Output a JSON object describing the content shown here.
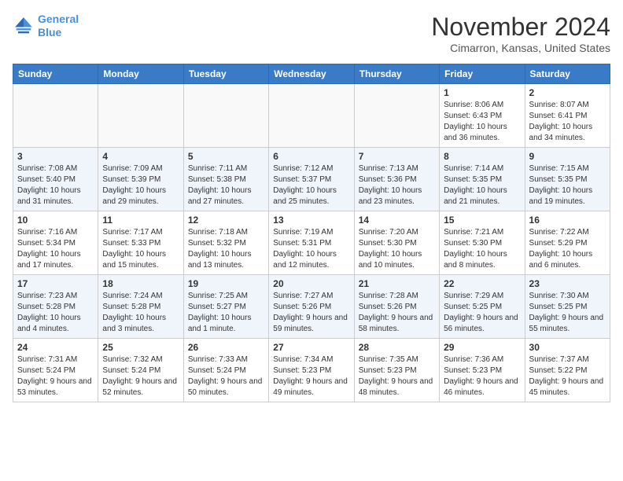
{
  "header": {
    "logo_line1": "General",
    "logo_line2": "Blue",
    "month": "November 2024",
    "location": "Cimarron, Kansas, United States"
  },
  "days_of_week": [
    "Sunday",
    "Monday",
    "Tuesday",
    "Wednesday",
    "Thursday",
    "Friday",
    "Saturday"
  ],
  "weeks": [
    [
      {
        "day": "",
        "info": ""
      },
      {
        "day": "",
        "info": ""
      },
      {
        "day": "",
        "info": ""
      },
      {
        "day": "",
        "info": ""
      },
      {
        "day": "",
        "info": ""
      },
      {
        "day": "1",
        "info": "Sunrise: 8:06 AM\nSunset: 6:43 PM\nDaylight: 10 hours and 36 minutes."
      },
      {
        "day": "2",
        "info": "Sunrise: 8:07 AM\nSunset: 6:41 PM\nDaylight: 10 hours and 34 minutes."
      }
    ],
    [
      {
        "day": "3",
        "info": "Sunrise: 7:08 AM\nSunset: 5:40 PM\nDaylight: 10 hours and 31 minutes."
      },
      {
        "day": "4",
        "info": "Sunrise: 7:09 AM\nSunset: 5:39 PM\nDaylight: 10 hours and 29 minutes."
      },
      {
        "day": "5",
        "info": "Sunrise: 7:11 AM\nSunset: 5:38 PM\nDaylight: 10 hours and 27 minutes."
      },
      {
        "day": "6",
        "info": "Sunrise: 7:12 AM\nSunset: 5:37 PM\nDaylight: 10 hours and 25 minutes."
      },
      {
        "day": "7",
        "info": "Sunrise: 7:13 AM\nSunset: 5:36 PM\nDaylight: 10 hours and 23 minutes."
      },
      {
        "day": "8",
        "info": "Sunrise: 7:14 AM\nSunset: 5:35 PM\nDaylight: 10 hours and 21 minutes."
      },
      {
        "day": "9",
        "info": "Sunrise: 7:15 AM\nSunset: 5:35 PM\nDaylight: 10 hours and 19 minutes."
      }
    ],
    [
      {
        "day": "10",
        "info": "Sunrise: 7:16 AM\nSunset: 5:34 PM\nDaylight: 10 hours and 17 minutes."
      },
      {
        "day": "11",
        "info": "Sunrise: 7:17 AM\nSunset: 5:33 PM\nDaylight: 10 hours and 15 minutes."
      },
      {
        "day": "12",
        "info": "Sunrise: 7:18 AM\nSunset: 5:32 PM\nDaylight: 10 hours and 13 minutes."
      },
      {
        "day": "13",
        "info": "Sunrise: 7:19 AM\nSunset: 5:31 PM\nDaylight: 10 hours and 12 minutes."
      },
      {
        "day": "14",
        "info": "Sunrise: 7:20 AM\nSunset: 5:30 PM\nDaylight: 10 hours and 10 minutes."
      },
      {
        "day": "15",
        "info": "Sunrise: 7:21 AM\nSunset: 5:30 PM\nDaylight: 10 hours and 8 minutes."
      },
      {
        "day": "16",
        "info": "Sunrise: 7:22 AM\nSunset: 5:29 PM\nDaylight: 10 hours and 6 minutes."
      }
    ],
    [
      {
        "day": "17",
        "info": "Sunrise: 7:23 AM\nSunset: 5:28 PM\nDaylight: 10 hours and 4 minutes."
      },
      {
        "day": "18",
        "info": "Sunrise: 7:24 AM\nSunset: 5:28 PM\nDaylight: 10 hours and 3 minutes."
      },
      {
        "day": "19",
        "info": "Sunrise: 7:25 AM\nSunset: 5:27 PM\nDaylight: 10 hours and 1 minute."
      },
      {
        "day": "20",
        "info": "Sunrise: 7:27 AM\nSunset: 5:26 PM\nDaylight: 9 hours and 59 minutes."
      },
      {
        "day": "21",
        "info": "Sunrise: 7:28 AM\nSunset: 5:26 PM\nDaylight: 9 hours and 58 minutes."
      },
      {
        "day": "22",
        "info": "Sunrise: 7:29 AM\nSunset: 5:25 PM\nDaylight: 9 hours and 56 minutes."
      },
      {
        "day": "23",
        "info": "Sunrise: 7:30 AM\nSunset: 5:25 PM\nDaylight: 9 hours and 55 minutes."
      }
    ],
    [
      {
        "day": "24",
        "info": "Sunrise: 7:31 AM\nSunset: 5:24 PM\nDaylight: 9 hours and 53 minutes."
      },
      {
        "day": "25",
        "info": "Sunrise: 7:32 AM\nSunset: 5:24 PM\nDaylight: 9 hours and 52 minutes."
      },
      {
        "day": "26",
        "info": "Sunrise: 7:33 AM\nSunset: 5:24 PM\nDaylight: 9 hours and 50 minutes."
      },
      {
        "day": "27",
        "info": "Sunrise: 7:34 AM\nSunset: 5:23 PM\nDaylight: 9 hours and 49 minutes."
      },
      {
        "day": "28",
        "info": "Sunrise: 7:35 AM\nSunset: 5:23 PM\nDaylight: 9 hours and 48 minutes."
      },
      {
        "day": "29",
        "info": "Sunrise: 7:36 AM\nSunset: 5:23 PM\nDaylight: 9 hours and 46 minutes."
      },
      {
        "day": "30",
        "info": "Sunrise: 7:37 AM\nSunset: 5:22 PM\nDaylight: 9 hours and 45 minutes."
      }
    ]
  ]
}
